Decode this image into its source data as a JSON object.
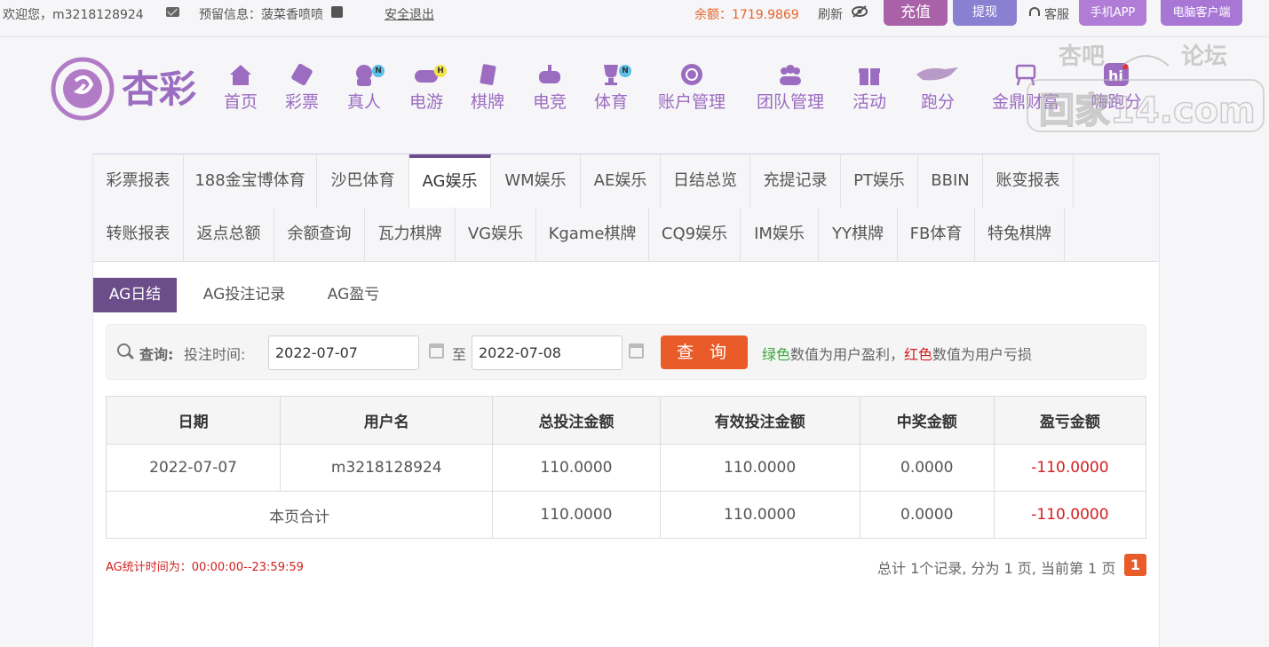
{
  "topbar": {
    "welcome": "欢迎您，m3218128924",
    "reserved_info": "预留信息：菠菜香喷喷",
    "logout": "安全退出",
    "balance": "余额：1719.9869",
    "refresh": "刷新",
    "deposit": "充值",
    "withdraw": "提现",
    "service": "客服",
    "mobile_app": "手机APP",
    "pc_client": "电脑客户端"
  },
  "logo": {
    "text": "杏彩"
  },
  "nav": [
    {
      "label": "首页",
      "icon": "home-icon"
    },
    {
      "label": "彩票",
      "icon": "lottery-ticket-icon"
    },
    {
      "label": "真人",
      "icon": "live-dealer-icon",
      "badge": "N"
    },
    {
      "label": "电游",
      "icon": "gamepad-icon",
      "badge": "H"
    },
    {
      "label": "棋牌",
      "icon": "cards-icon"
    },
    {
      "label": "电竞",
      "icon": "joystick-icon"
    },
    {
      "label": "体育",
      "icon": "trophy-icon",
      "badge": "N"
    },
    {
      "label": "账户管理",
      "icon": "account-icon"
    },
    {
      "label": "团队管理",
      "icon": "team-icon"
    },
    {
      "label": "活动",
      "icon": "gift-icon"
    },
    {
      "label": "跑分",
      "icon": "running-animal-icon"
    },
    {
      "label": "金鼎财富",
      "icon": "tripod-icon"
    },
    {
      "label": "嗨跑分",
      "icon": "hi-icon"
    }
  ],
  "watermark": {
    "line1": "杏吧",
    "line2": "论坛",
    "domain": "回家14.com"
  },
  "tabs_row1": [
    "彩票报表",
    "188金宝博体育",
    "沙巴体育",
    "AG娱乐",
    "WM娱乐",
    "AE娱乐",
    "日结总览",
    "充提记录",
    "PT娱乐",
    "BBIN",
    "账变报表"
  ],
  "tabs_row2": [
    "转账报表",
    "返点总额",
    "余额查询",
    "瓦力棋牌",
    "VG娱乐",
    "Kgame棋牌",
    "CQ9娱乐",
    "IM娱乐",
    "YY棋牌",
    "FB体育",
    "特兔棋牌"
  ],
  "subtabs": [
    "AG日结",
    "AG投注记录",
    "AG盈亏"
  ],
  "query": {
    "label": "查询:",
    "time_label": "投注时间:",
    "start_date": "2022-07-07",
    "to": "至",
    "end_date": "2022-07-08",
    "button": "查 询",
    "hint_green": "绿色",
    "hint_mid": "数值为用户盈利，",
    "hint_red": "红色",
    "hint_end": "数值为用户亏损"
  },
  "table": {
    "headers": [
      "日期",
      "用户名",
      "总投注金额",
      "有效投注金额",
      "中奖金额",
      "盈亏金额"
    ],
    "rows": [
      [
        "2022-07-07",
        "m3218128924",
        "110.0000",
        "110.0000",
        "0.0000",
        "-110.0000"
      ]
    ],
    "total": [
      "本页合计",
      "110.0000",
      "110.0000",
      "0.0000",
      "-110.0000"
    ]
  },
  "footer": {
    "stat_note": "AG统计时间为：00:00:00--23:59:59",
    "pager_text": "总计 1个记录, 分为 1 页, 当前第 1 页",
    "current_page": "1"
  },
  "colors": {
    "accent_purple": "#6b4d8a",
    "nav_purple": "#9b6cc0",
    "orange": "#e95c2a",
    "loss_red": "#d21f1f",
    "profit_green": "#3aa83a"
  }
}
